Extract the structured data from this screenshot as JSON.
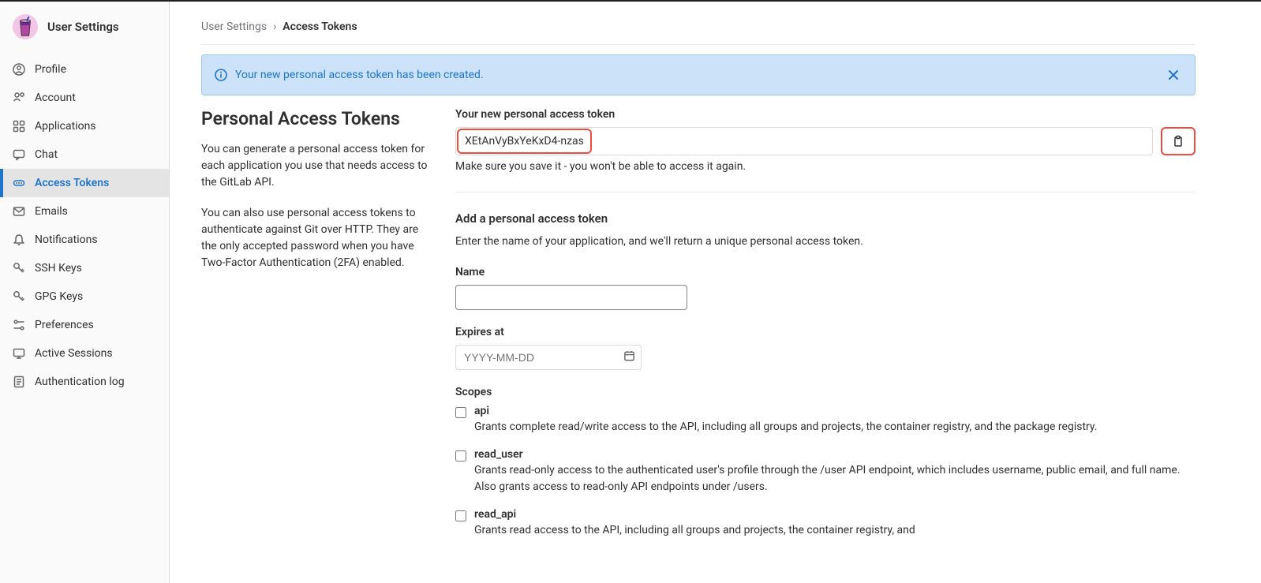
{
  "sidebar": {
    "title": "User Settings",
    "items": [
      {
        "label": "Profile",
        "icon": "profile"
      },
      {
        "label": "Account",
        "icon": "account"
      },
      {
        "label": "Applications",
        "icon": "applications"
      },
      {
        "label": "Chat",
        "icon": "chat"
      },
      {
        "label": "Access Tokens",
        "icon": "token",
        "active": true
      },
      {
        "label": "Emails",
        "icon": "email"
      },
      {
        "label": "Notifications",
        "icon": "bell"
      },
      {
        "label": "SSH Keys",
        "icon": "key"
      },
      {
        "label": "GPG Keys",
        "icon": "key"
      },
      {
        "label": "Preferences",
        "icon": "prefs"
      },
      {
        "label": "Active Sessions",
        "icon": "sessions"
      },
      {
        "label": "Authentication log",
        "icon": "log"
      }
    ]
  },
  "breadcrumb": {
    "parent": "User Settings",
    "sep": "›",
    "current": "Access Tokens"
  },
  "alert": {
    "text": "Your new personal access token has been created."
  },
  "left": {
    "title": "Personal Access Tokens",
    "p1": "You can generate a personal access token for each application you use that needs access to the GitLab API.",
    "p2": "You can also use personal access tokens to authenticate against Git over HTTP. They are the only accepted password when you have Two-Factor Authentication (2FA) enabled."
  },
  "token": {
    "label": "Your new personal access token",
    "value": "XEtAnVyBxYeKxD4-nzas",
    "hint": "Make sure you save it - you won't be able to access it again."
  },
  "add": {
    "heading": "Add a personal access token",
    "desc": "Enter the name of your application, and we'll return a unique personal access token.",
    "name_label": "Name",
    "expires_label": "Expires at",
    "expires_placeholder": "YYYY-MM-DD",
    "scopes_label": "Scopes"
  },
  "scopes": [
    {
      "name": "api",
      "desc": "Grants complete read/write access to the API, including all groups and projects, the container registry, and the package registry."
    },
    {
      "name": "read_user",
      "desc": "Grants read-only access to the authenticated user's profile through the /user API endpoint, which includes username, public email, and full name. Also grants access to read-only API endpoints under /users."
    },
    {
      "name": "read_api",
      "desc": "Grants read access to the API, including all groups and projects, the container registry, and"
    }
  ]
}
